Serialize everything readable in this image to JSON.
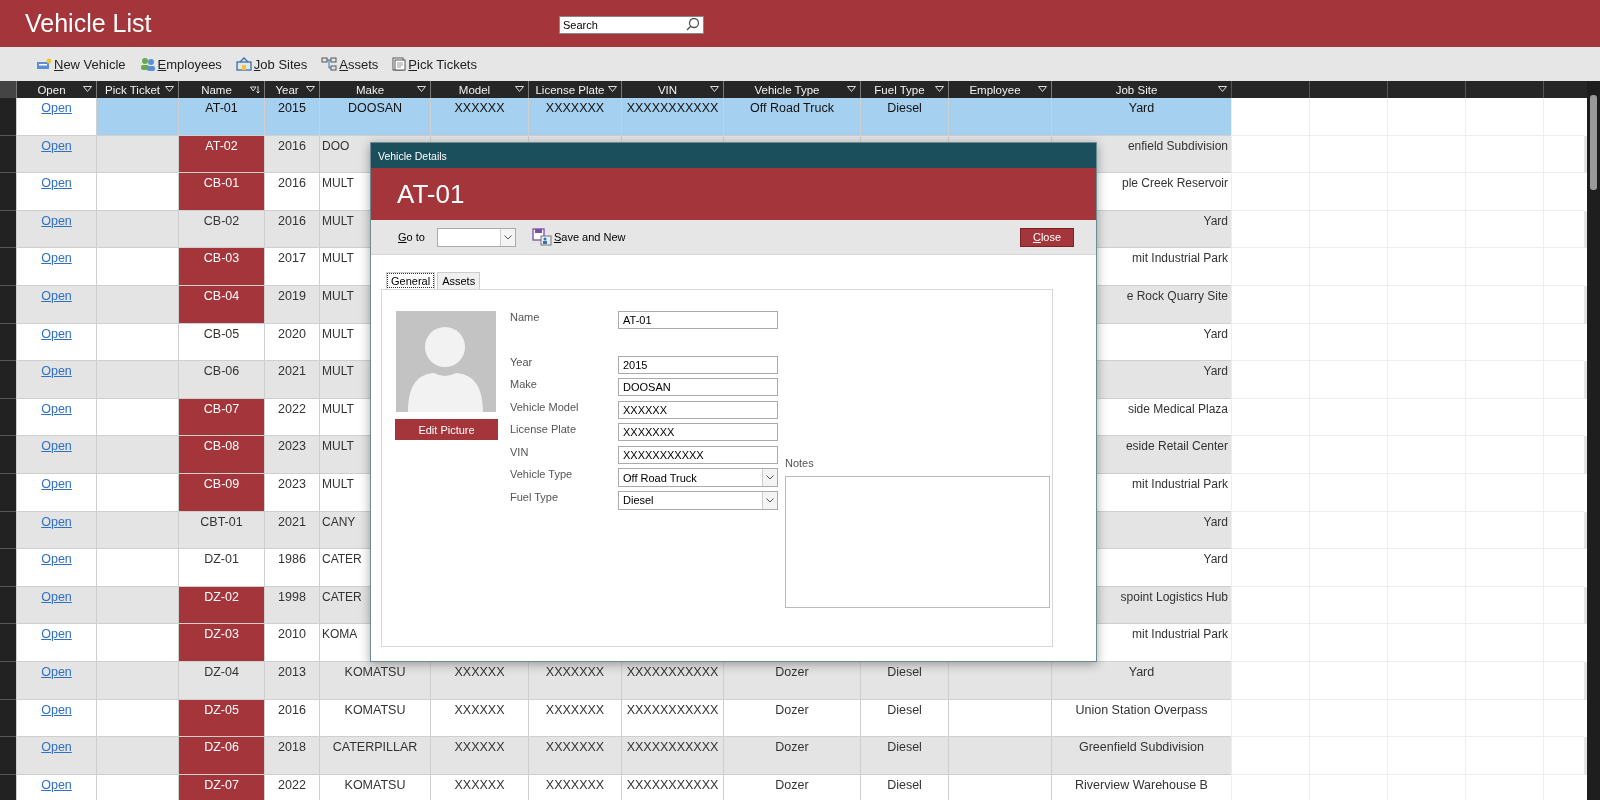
{
  "app": {
    "title": "Vehicle List"
  },
  "search": {
    "placeholder": "Search"
  },
  "toolbar": [
    {
      "label": "New Vehicle",
      "kind": "new"
    },
    {
      "label": "Employees",
      "kind": "people"
    },
    {
      "label": "Job Sites",
      "kind": "site"
    },
    {
      "label": "Assets",
      "kind": "assets"
    },
    {
      "label": "Pick Tickets",
      "kind": "tickets"
    }
  ],
  "table": {
    "columns": [
      {
        "label": "Open",
        "kind": "filter"
      },
      {
        "label": "Pick Ticket",
        "kind": "filter"
      },
      {
        "label": "Name",
        "kind": "sort"
      },
      {
        "label": "Year",
        "kind": "filter"
      },
      {
        "label": "Make",
        "kind": "filter"
      },
      {
        "label": "Model",
        "kind": "filter"
      },
      {
        "label": "License Plate",
        "kind": "filter"
      },
      {
        "label": "VIN",
        "kind": "filter"
      },
      {
        "label": "Vehicle Type",
        "kind": "filter"
      },
      {
        "label": "Fuel Type",
        "kind": "filter"
      },
      {
        "label": "Employee",
        "kind": "filter"
      },
      {
        "label": "Job Site",
        "kind": "filter"
      }
    ],
    "rows": [
      {
        "open": "Open",
        "name": "AT-01",
        "year": "2015",
        "make": "DOOSAN",
        "model": "XXXXXX",
        "license_plate": "XXXXXXX",
        "vin": "XXXXXXXXXXX",
        "vehicle_type": "Off Road Truck",
        "fuel_type": "Diesel",
        "job_site": "Yard",
        "selected": true,
        "flagged": false
      },
      {
        "open": "Open",
        "name": "AT-02",
        "year": "2016",
        "make": "DOO",
        "job_site": "enfield Subdivision",
        "selected": false,
        "flagged": true
      },
      {
        "open": "Open",
        "name": "CB-01",
        "year": "2016",
        "make": "MULT",
        "job_site": "ple Creek Reservoir",
        "selected": false,
        "flagged": true
      },
      {
        "open": "Open",
        "name": "CB-02",
        "year": "2016",
        "make": "MULT",
        "job_site": "Yard",
        "selected": false,
        "flagged": false
      },
      {
        "open": "Open",
        "name": "CB-03",
        "year": "2017",
        "make": "MULT",
        "job_site": "mit Industrial Park",
        "selected": false,
        "flagged": true
      },
      {
        "open": "Open",
        "name": "CB-04",
        "year": "2019",
        "make": "MULT",
        "job_site": "e Rock Quarry Site",
        "selected": false,
        "flagged": true
      },
      {
        "open": "Open",
        "name": "CB-05",
        "year": "2020",
        "make": "MULT",
        "job_site": "Yard",
        "selected": false,
        "flagged": false
      },
      {
        "open": "Open",
        "name": "CB-06",
        "year": "2021",
        "make": "MULT",
        "job_site": "Yard",
        "selected": false,
        "flagged": false
      },
      {
        "open": "Open",
        "name": "CB-07",
        "year": "2022",
        "make": "MULT",
        "job_site": "side Medical Plaza",
        "selected": false,
        "flagged": true
      },
      {
        "open": "Open",
        "name": "CB-08",
        "year": "2023",
        "make": "MULT",
        "job_site": "eside Retail Center",
        "selected": false,
        "flagged": true
      },
      {
        "open": "Open",
        "name": "CB-09",
        "year": "2023",
        "make": "MULT",
        "job_site": "mit Industrial Park",
        "selected": false,
        "flagged": true
      },
      {
        "open": "Open",
        "name": "CBT-01",
        "year": "2021",
        "make": "CANY",
        "job_site": "Yard",
        "selected": false,
        "flagged": false
      },
      {
        "open": "Open",
        "name": "DZ-01",
        "year": "1986",
        "make": "CATER",
        "job_site": "Yard",
        "selected": false,
        "flagged": false
      },
      {
        "open": "Open",
        "name": "DZ-02",
        "year": "1998",
        "make": "CATER",
        "job_site": "spoint Logistics Hub",
        "selected": false,
        "flagged": true
      },
      {
        "open": "Open",
        "name": "DZ-03",
        "year": "2010",
        "make": "KOMA",
        "job_site": "mit Industrial Park",
        "selected": false,
        "flagged": true
      },
      {
        "open": "Open",
        "name": "DZ-04",
        "year": "2013",
        "make": "KOMATSU",
        "model": "XXXXXX",
        "license_plate": "XXXXXXX",
        "vin": "XXXXXXXXXXX",
        "vehicle_type": "Dozer",
        "fuel_type": "Diesel",
        "job_site": "Yard",
        "selected": false,
        "flagged": false
      },
      {
        "open": "Open",
        "name": "DZ-05",
        "year": "2016",
        "make": "KOMATSU",
        "model": "XXXXXX",
        "license_plate": "XXXXXXX",
        "vin": "XXXXXXXXXXX",
        "vehicle_type": "Dozer",
        "fuel_type": "Diesel",
        "job_site": "Union Station Overpass",
        "selected": false,
        "flagged": true
      },
      {
        "open": "Open",
        "name": "DZ-06",
        "year": "2018",
        "make": "CATERPILLAR",
        "model": "XXXXXX",
        "license_plate": "XXXXXXX",
        "vin": "XXXXXXXXXXX",
        "vehicle_type": "Dozer",
        "fuel_type": "Diesel",
        "job_site": "Greenfield Subdivision",
        "selected": false,
        "flagged": true
      },
      {
        "open": "Open",
        "name": "DZ-07",
        "year": "2022",
        "make": "KOMATSU",
        "model": "XXXXXX",
        "license_plate": "XXXXXXX",
        "vin": "XXXXXXXXXXX",
        "vehicle_type": "Dozer",
        "fuel_type": "Diesel",
        "job_site": "Riverview Warehouse B",
        "selected": false,
        "flagged": true
      }
    ]
  },
  "dialog": {
    "title": "Vehicle Details",
    "heading": "AT-01",
    "goto_label": "Go to",
    "save_new": "Save and New",
    "close": "Close",
    "tabs": [
      {
        "label": "General",
        "selected": true
      },
      {
        "label": "Assets",
        "selected": false
      }
    ],
    "edit_picture": "Edit Picture",
    "fields": [
      {
        "label": "Name",
        "value": "AT-01",
        "kind": "text"
      },
      {
        "label": "Year",
        "value": "2015",
        "kind": "text"
      },
      {
        "label": "Make",
        "value": "DOOSAN",
        "kind": "text"
      },
      {
        "label": "Vehicle Model",
        "value": "XXXXXX",
        "kind": "text"
      },
      {
        "label": "License Plate",
        "value": "XXXXXXX",
        "kind": "text"
      },
      {
        "label": "VIN",
        "value": "XXXXXXXXXXX",
        "kind": "text"
      },
      {
        "label": "Vehicle Type",
        "value": "Off Road Truck",
        "kind": "combo"
      },
      {
        "label": "Fuel Type",
        "value": "Diesel",
        "kind": "combo"
      }
    ],
    "notes_label": "Notes"
  }
}
